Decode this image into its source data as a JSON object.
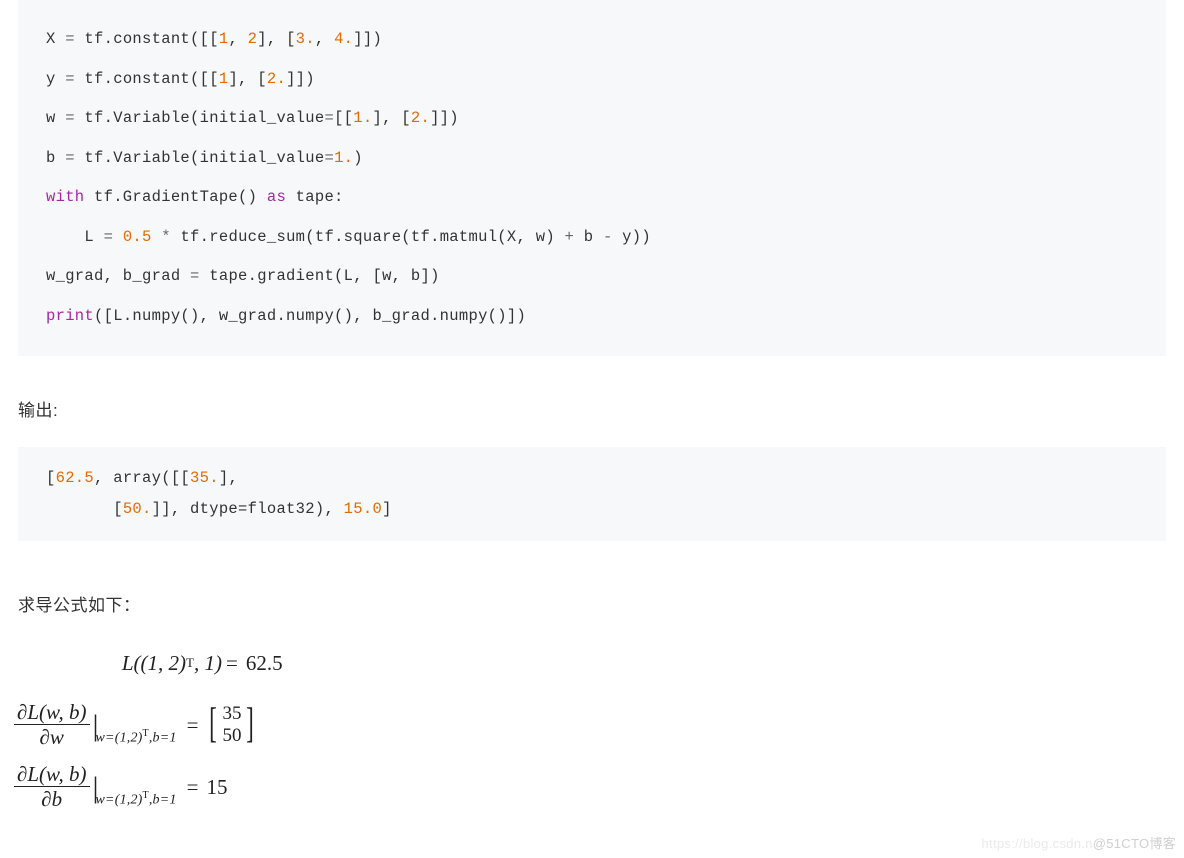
{
  "code": {
    "l1a": "X ",
    "l1b": "=",
    "l1c": " tf.constant([[",
    "l1d": "1",
    "l1e": ", ",
    "l1f": "2",
    "l1g": "], [",
    "l1h": "3.",
    "l1i": ", ",
    "l1j": "4.",
    "l1k": "]])",
    "l2a": "y ",
    "l2b": "=",
    "l2c": " tf.constant([[",
    "l2d": "1",
    "l2e": "], [",
    "l2f": "2.",
    "l2g": "]])",
    "l3a": "w ",
    "l3b": "=",
    "l3c": " tf.Variable(initial_value",
    "l3d": "=",
    "l3e": "[[",
    "l3f": "1.",
    "l3g": "], [",
    "l3h": "2.",
    "l3i": "]])",
    "l4a": "b ",
    "l4b": "=",
    "l4c": " tf.Variable(initial_value",
    "l4d": "=",
    "l4e": "1.",
    "l4f": ")",
    "l5a": "with",
    "l5b": " tf.GradientTape() ",
    "l5c": "as",
    "l5d": " tape:",
    "l6a": "    L ",
    "l6b": "=",
    "l6c": " ",
    "l6d": "0.5",
    "l6e": " ",
    "l6f": "*",
    "l6g": " tf.reduce_sum(tf.square(tf.matmul(X, w) ",
    "l6h": "+",
    "l6i": " b ",
    "l6j": "-",
    "l6k": " y))",
    "l7a": "w_grad, b_grad ",
    "l7b": "=",
    "l7c": " tape.gradient(L, [w, b])",
    "l8a": "print",
    "l8b": "([L.numpy(), w_grad.numpy(), b_grad.numpy()])"
  },
  "texts": {
    "output_label": "输出:",
    "derivative_label": "求导公式如下："
  },
  "output": {
    "o1a": "[",
    "o1b": "62.5",
    "o1c": ", array([[",
    "o1d": "35.",
    "o1e": "],",
    "o2a": "       [",
    "o2b": "50.",
    "o2c": "]], dtype",
    "o2d": "=",
    "o2e": "float32), ",
    "o2f": "15.0",
    "o2g": "]"
  },
  "math": {
    "row1_left": "L((1, 2)",
    "row1_sup": "T",
    "row1_after": ", 1)",
    "row1_val": "62.5",
    "partial_top": "∂L(w, b)",
    "dw_bot": "∂w",
    "db_bot": "∂b",
    "eval_sub": "w=(1,2)",
    "eval_sup": "T",
    "eval_rest": ",b=1",
    "m_top": "35",
    "m_bot": "50",
    "row3_val": "15"
  },
  "watermark": {
    "faint": "https://blog.csdn.n",
    "text": "@51CTO博客"
  }
}
